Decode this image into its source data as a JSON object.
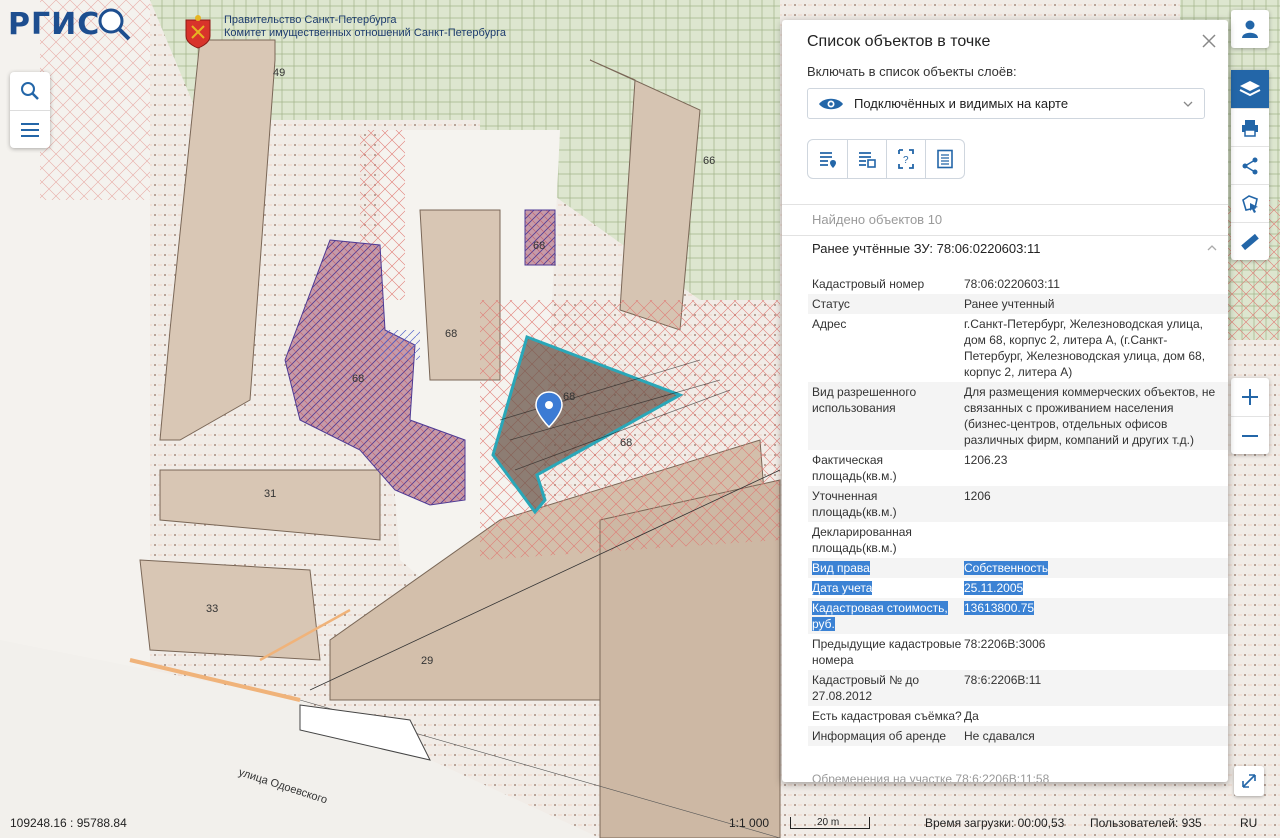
{
  "header": {
    "logo_text": "РГИС",
    "gov_line1": "Правительство Санкт-Петербурга",
    "gov_line2": "Комитет имущественных отношений Санкт-Петербурга"
  },
  "map": {
    "labels": [
      "49",
      "66",
      "68",
      "68",
      "68",
      "68",
      "68",
      "31",
      "33",
      "29"
    ],
    "street": "улица Одоевского"
  },
  "panel": {
    "title": "Список объектов в точке",
    "include_label": "Включать в список объекты слоёв:",
    "layer_select": "Подключённых и видимых на карте",
    "found": "Найдено объектов 10",
    "object_title": "Ранее учтённые ЗУ: 78:06:0220603:11",
    "attributes": [
      {
        "k": "Кадастровый номер",
        "v": "78:06:0220603:11",
        "sel": false
      },
      {
        "k": "Статус",
        "v": "Ранее учтенный",
        "sel": false
      },
      {
        "k": "Адрес",
        "v": "г.Санкт-Петербург, Железноводская улица, дом 68, корпус 2, литера А, (г.Санкт-Петербург, Железноводская улица, дом 68, корпус 2, литера А)",
        "sel": false
      },
      {
        "k": "Вид разрешенного использования",
        "v": "Для размещения коммерческих объектов, не связанных с проживанием населения (бизнес-центров, отдельных офисов различных фирм, компаний и других т.д.)",
        "sel": false
      },
      {
        "k": "Фактическая площадь(кв.м.)",
        "v": "1206.23",
        "sel": false
      },
      {
        "k": "Уточненная площадь(кв.м.)",
        "v": "1206",
        "sel": false
      },
      {
        "k": "Декларированная площадь(кв.м.)",
        "v": "",
        "sel": false
      },
      {
        "k": "Вид права",
        "v": "Собственность",
        "sel": true
      },
      {
        "k": "Дата учета",
        "v": "25.11.2005",
        "sel": true
      },
      {
        "k": "Кадастровая стоимость, руб.",
        "v": "13613800.75",
        "sel": true
      },
      {
        "k": "Предыдущие кадастровые номера",
        "v": "78:2206В:3006",
        "sel": false
      },
      {
        "k": "Кадастровый № до 27.08.2012",
        "v": "78:6:2206В:11",
        "sel": false
      },
      {
        "k": "Есть кадастровая съёмка?",
        "v": "Да",
        "sel": false
      },
      {
        "k": "Информация об аренде",
        "v": "Не сдавался",
        "sel": false
      }
    ],
    "cut_row": "Обременения на участке     78:6:2206В:11:58"
  },
  "status": {
    "coords": "109248.16 : 95788.84",
    "scale": "1:1 000",
    "scalebar": "20 m",
    "loadtime": "Время загрузки: 00:00,53",
    "users": "Пользователей: 935",
    "lang": "RU"
  },
  "icons": [
    "search-icon",
    "menu-icon",
    "user-icon",
    "layers-icon",
    "print-icon",
    "share-icon",
    "select-icon",
    "ruler-icon",
    "zoom-in-icon",
    "zoom-out-icon",
    "close-icon",
    "eye-icon",
    "chevron-down-icon",
    "chevron-up-icon",
    "expand-icon"
  ],
  "colors": {
    "accent": "#2366a8",
    "selection": "#3b82d4",
    "parcel": "#c9b3a0",
    "highlight": "#2aa7b8"
  }
}
